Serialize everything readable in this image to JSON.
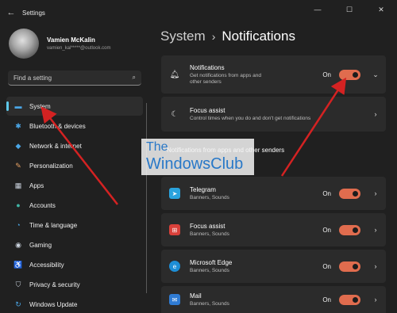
{
  "window": {
    "title": "Settings",
    "back_glyph": "←",
    "controls": [
      "—",
      "☐",
      "✕"
    ]
  },
  "profile": {
    "name": "Vamien McKalin",
    "email": "vamien_kal*****@outlook.com"
  },
  "search": {
    "placeholder": "Find a setting",
    "icon": "search-icon"
  },
  "nav": {
    "items": [
      {
        "label": "System",
        "icon": "monitor-icon",
        "glyph": "▬",
        "color": "#4aa6e6"
      },
      {
        "label": "Bluetooth & devices",
        "icon": "bluetooth-icon",
        "glyph": "✱",
        "color": "#4aa6e6"
      },
      {
        "label": "Network & internet",
        "icon": "wifi-icon",
        "glyph": "◆",
        "color": "#4aa6e6"
      },
      {
        "label": "Personalization",
        "icon": "brush-icon",
        "glyph": "✎",
        "color": "#e8a264"
      },
      {
        "label": "Apps",
        "icon": "apps-icon",
        "glyph": "▦",
        "color": "#c9d1dc"
      },
      {
        "label": "Accounts",
        "icon": "person-icon",
        "glyph": "●",
        "color": "#3fb4a4"
      },
      {
        "label": "Time & language",
        "icon": "globe-icon",
        "glyph": "◔",
        "color": "#4aa6e6"
      },
      {
        "label": "Gaming",
        "icon": "gamepad-icon",
        "glyph": "◉",
        "color": "#c9d1dc"
      },
      {
        "label": "Accessibility",
        "icon": "accessibility-icon",
        "glyph": "♿",
        "color": "#4aa6e6"
      },
      {
        "label": "Privacy & security",
        "icon": "shield-icon",
        "glyph": "⛉",
        "color": "#c9d1dc"
      },
      {
        "label": "Windows Update",
        "icon": "update-icon",
        "glyph": "↻",
        "color": "#4aa6e6"
      }
    ]
  },
  "breadcrumb": {
    "parent": "System",
    "separator": "›",
    "current": "Notifications"
  },
  "notifications_card": {
    "title": "Notifications",
    "subtitle_line1": "Get notifications from apps and",
    "subtitle_line2": "other senders",
    "state": "On",
    "icon": "bell-icon",
    "chevron": "⌄"
  },
  "focus_card": {
    "title": "Focus assist",
    "subtitle": "Control times when you do and don't get notifications",
    "icon": "moon-icon",
    "chevron": "›"
  },
  "section": {
    "title": "Notifications from apps and other senders"
  },
  "apps": [
    {
      "name": "Telegram",
      "sub": "Banners, Sounds",
      "state": "On",
      "icon": "telegram-icon",
      "glyph": "➤",
      "bg": "#2aa3dd"
    },
    {
      "name": "Focus assist",
      "sub": "Banners, Sounds",
      "state": "On",
      "icon": "focus-assist-icon",
      "glyph": "⊞",
      "bg": "#d9403a"
    },
    {
      "name": "Microsoft Edge",
      "sub": "Banners, Sounds",
      "state": "On",
      "icon": "edge-icon",
      "glyph": "e",
      "bg": "#1d8ed6"
    },
    {
      "name": "Mail",
      "sub": "Banners, Sounds",
      "state": "On",
      "icon": "mail-icon",
      "glyph": "✉",
      "bg": "#2f7bd3"
    }
  ],
  "watermark": {
    "line1": "The",
    "line2": "WindowsClub"
  },
  "colors": {
    "accent": "#5ec8ea",
    "toggle_on": "#e06c4e",
    "arrow": "#d42222"
  }
}
